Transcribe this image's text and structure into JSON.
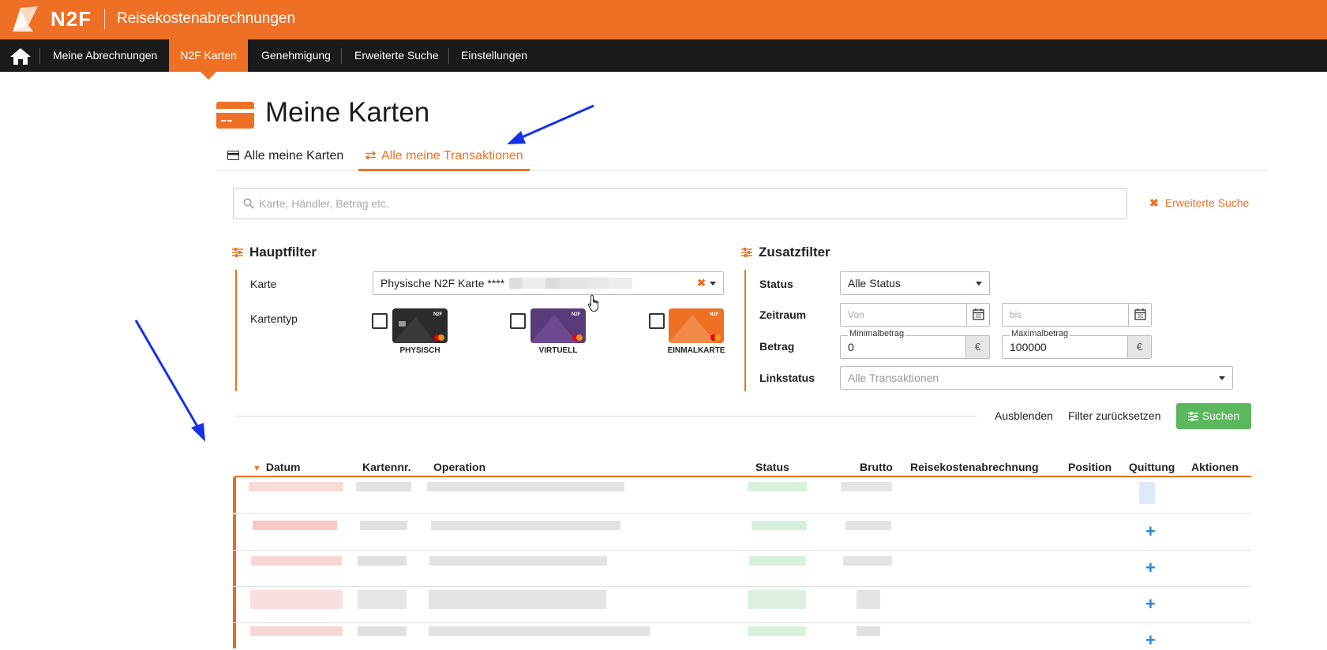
{
  "header": {
    "logo_text": "N2F",
    "app_title": "Reisekostenabrechnungen",
    "brand_color": "#ee7025"
  },
  "nav": {
    "home_icon": "home-icon",
    "items": [
      {
        "label": "Meine Abrechnungen"
      },
      {
        "label": "N2F Karten"
      },
      {
        "label": "Genehmigung"
      },
      {
        "label": "Erweiterte Suche"
      },
      {
        "label": "Einstellungen"
      }
    ],
    "active_index": 1
  },
  "page": {
    "title": "Meine Karten",
    "icon": "credit-card-icon"
  },
  "tabs": [
    {
      "label": "Alle meine Karten",
      "icon": "card-icon"
    },
    {
      "label": "Alle meine Transaktionen",
      "icon": "transfer-icon"
    }
  ],
  "search": {
    "placeholder": "Karte, Händler, Betrag etc.",
    "advanced_label": "Erweiterte Suche"
  },
  "main_filter": {
    "title": "Hauptfilter",
    "card_label": "Karte",
    "card_value": "Physische N2F Karte ****",
    "cardtype_label": "Kartentyp",
    "card_types": [
      {
        "label": "PHYSISCH",
        "color": "#2b2b2b"
      },
      {
        "label": "VIRTUELL",
        "color": "#5a3b7a"
      },
      {
        "label": "EINMALKARTE",
        "color": "#ee7025"
      }
    ]
  },
  "extra_filter": {
    "title": "Zusatzfilter",
    "status_label": "Status",
    "status_value": "Alle Status",
    "period_label": "Zeitraum",
    "from_placeholder": "Von",
    "to_placeholder": "bis",
    "amount_label": "Betrag",
    "min_label": "Minimalbetrag",
    "min_value": "0",
    "max_label": "Maximalbetrag",
    "max_value": "100000",
    "currency": "€",
    "link_label": "Linkstatus",
    "link_value": "Alle Transaktionen"
  },
  "actions": {
    "hide": "Ausblenden",
    "reset": "Filter zurücksetzen",
    "search": "Suchen"
  },
  "table": {
    "columns": [
      "Datum",
      "Kartennr.",
      "Operation",
      "Status",
      "Brutto",
      "Reisekostenabrechnung",
      "Position",
      "Quittung",
      "Aktionen"
    ],
    "sort_indicator": "▼",
    "add_symbol": "+"
  }
}
